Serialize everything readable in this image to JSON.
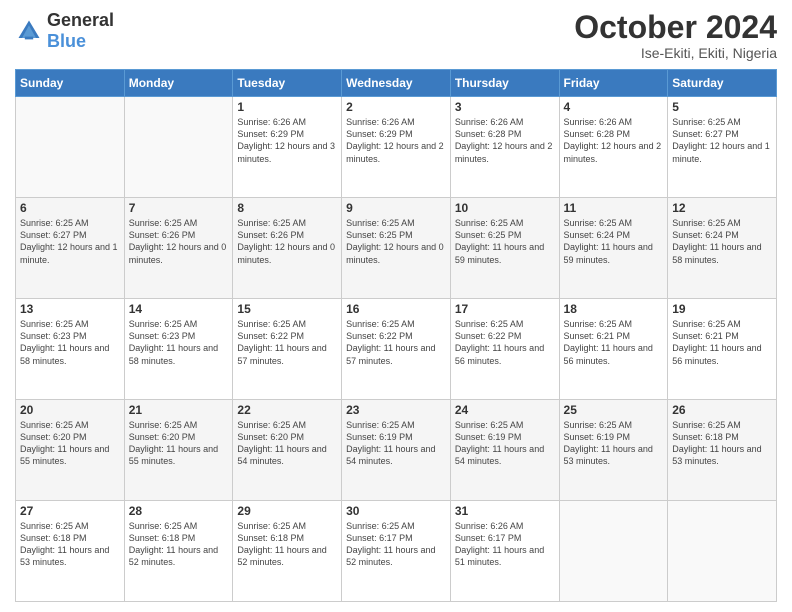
{
  "header": {
    "logo": {
      "general": "General",
      "blue": "Blue"
    },
    "title": "October 2024",
    "location": "Ise-Ekiti, Ekiti, Nigeria"
  },
  "calendar": {
    "days_of_week": [
      "Sunday",
      "Monday",
      "Tuesday",
      "Wednesday",
      "Thursday",
      "Friday",
      "Saturday"
    ],
    "weeks": [
      [
        {
          "day": null,
          "info": null
        },
        {
          "day": null,
          "info": null
        },
        {
          "day": "1",
          "info": "Sunrise: 6:26 AM\nSunset: 6:29 PM\nDaylight: 12 hours and 3 minutes."
        },
        {
          "day": "2",
          "info": "Sunrise: 6:26 AM\nSunset: 6:29 PM\nDaylight: 12 hours and 2 minutes."
        },
        {
          "day": "3",
          "info": "Sunrise: 6:26 AM\nSunset: 6:28 PM\nDaylight: 12 hours and 2 minutes."
        },
        {
          "day": "4",
          "info": "Sunrise: 6:26 AM\nSunset: 6:28 PM\nDaylight: 12 hours and 2 minutes."
        },
        {
          "day": "5",
          "info": "Sunrise: 6:25 AM\nSunset: 6:27 PM\nDaylight: 12 hours and 1 minute."
        }
      ],
      [
        {
          "day": "6",
          "info": "Sunrise: 6:25 AM\nSunset: 6:27 PM\nDaylight: 12 hours and 1 minute."
        },
        {
          "day": "7",
          "info": "Sunrise: 6:25 AM\nSunset: 6:26 PM\nDaylight: 12 hours and 0 minutes."
        },
        {
          "day": "8",
          "info": "Sunrise: 6:25 AM\nSunset: 6:26 PM\nDaylight: 12 hours and 0 minutes."
        },
        {
          "day": "9",
          "info": "Sunrise: 6:25 AM\nSunset: 6:25 PM\nDaylight: 12 hours and 0 minutes."
        },
        {
          "day": "10",
          "info": "Sunrise: 6:25 AM\nSunset: 6:25 PM\nDaylight: 11 hours and 59 minutes."
        },
        {
          "day": "11",
          "info": "Sunrise: 6:25 AM\nSunset: 6:24 PM\nDaylight: 11 hours and 59 minutes."
        },
        {
          "day": "12",
          "info": "Sunrise: 6:25 AM\nSunset: 6:24 PM\nDaylight: 11 hours and 58 minutes."
        }
      ],
      [
        {
          "day": "13",
          "info": "Sunrise: 6:25 AM\nSunset: 6:23 PM\nDaylight: 11 hours and 58 minutes."
        },
        {
          "day": "14",
          "info": "Sunrise: 6:25 AM\nSunset: 6:23 PM\nDaylight: 11 hours and 58 minutes."
        },
        {
          "day": "15",
          "info": "Sunrise: 6:25 AM\nSunset: 6:22 PM\nDaylight: 11 hours and 57 minutes."
        },
        {
          "day": "16",
          "info": "Sunrise: 6:25 AM\nSunset: 6:22 PM\nDaylight: 11 hours and 57 minutes."
        },
        {
          "day": "17",
          "info": "Sunrise: 6:25 AM\nSunset: 6:22 PM\nDaylight: 11 hours and 56 minutes."
        },
        {
          "day": "18",
          "info": "Sunrise: 6:25 AM\nSunset: 6:21 PM\nDaylight: 11 hours and 56 minutes."
        },
        {
          "day": "19",
          "info": "Sunrise: 6:25 AM\nSunset: 6:21 PM\nDaylight: 11 hours and 56 minutes."
        }
      ],
      [
        {
          "day": "20",
          "info": "Sunrise: 6:25 AM\nSunset: 6:20 PM\nDaylight: 11 hours and 55 minutes."
        },
        {
          "day": "21",
          "info": "Sunrise: 6:25 AM\nSunset: 6:20 PM\nDaylight: 11 hours and 55 minutes."
        },
        {
          "day": "22",
          "info": "Sunrise: 6:25 AM\nSunset: 6:20 PM\nDaylight: 11 hours and 54 minutes."
        },
        {
          "day": "23",
          "info": "Sunrise: 6:25 AM\nSunset: 6:19 PM\nDaylight: 11 hours and 54 minutes."
        },
        {
          "day": "24",
          "info": "Sunrise: 6:25 AM\nSunset: 6:19 PM\nDaylight: 11 hours and 54 minutes."
        },
        {
          "day": "25",
          "info": "Sunrise: 6:25 AM\nSunset: 6:19 PM\nDaylight: 11 hours and 53 minutes."
        },
        {
          "day": "26",
          "info": "Sunrise: 6:25 AM\nSunset: 6:18 PM\nDaylight: 11 hours and 53 minutes."
        }
      ],
      [
        {
          "day": "27",
          "info": "Sunrise: 6:25 AM\nSunset: 6:18 PM\nDaylight: 11 hours and 53 minutes."
        },
        {
          "day": "28",
          "info": "Sunrise: 6:25 AM\nSunset: 6:18 PM\nDaylight: 11 hours and 52 minutes."
        },
        {
          "day": "29",
          "info": "Sunrise: 6:25 AM\nSunset: 6:18 PM\nDaylight: 11 hours and 52 minutes."
        },
        {
          "day": "30",
          "info": "Sunrise: 6:25 AM\nSunset: 6:17 PM\nDaylight: 11 hours and 52 minutes."
        },
        {
          "day": "31",
          "info": "Sunrise: 6:26 AM\nSunset: 6:17 PM\nDaylight: 11 hours and 51 minutes."
        },
        {
          "day": null,
          "info": null
        },
        {
          "day": null,
          "info": null
        }
      ]
    ]
  }
}
